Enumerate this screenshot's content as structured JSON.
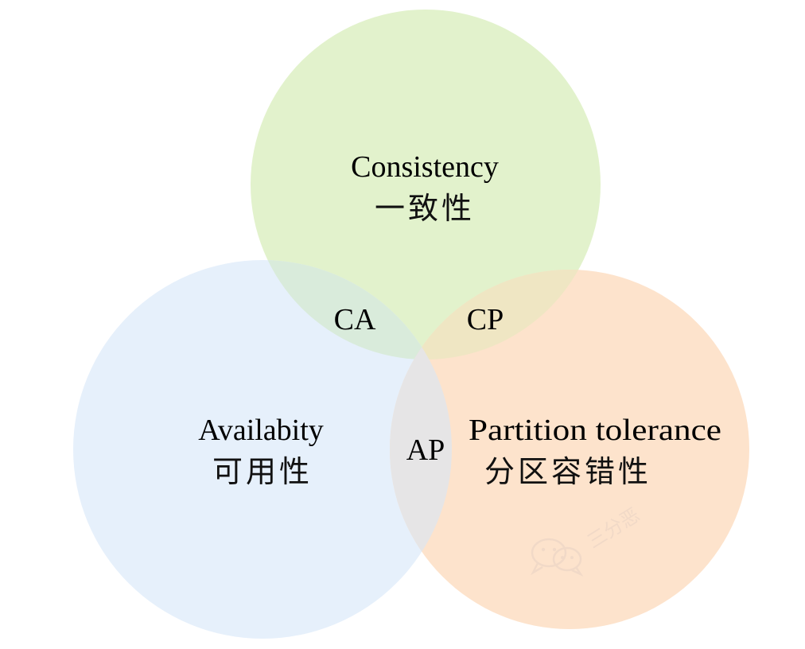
{
  "colors": {
    "background": "#ffffff",
    "consistency_fill": "#e2f2cc",
    "availability_fill": "#e6f0fb",
    "partition_fill": "#fde3cc",
    "ca_overlap_fill": "#d9ebdb",
    "cp_overlap_fill": "#efe6c3",
    "ap_overlap_fill": "#e6e5e6",
    "watermark": "#f0d9c7"
  },
  "circles": {
    "consistency": {
      "label_en": "Consistency",
      "label_cn": "一致性"
    },
    "availability": {
      "label_en": "Availabity",
      "label_cn": "可用性"
    },
    "partition": {
      "label_en": "Partition tolerance",
      "label_cn": "分区容错性"
    }
  },
  "overlaps": {
    "ca": "CA",
    "cp": "CP",
    "ap": "AP"
  },
  "watermark": {
    "icon": "wechat-icon",
    "text": "三分恶"
  }
}
